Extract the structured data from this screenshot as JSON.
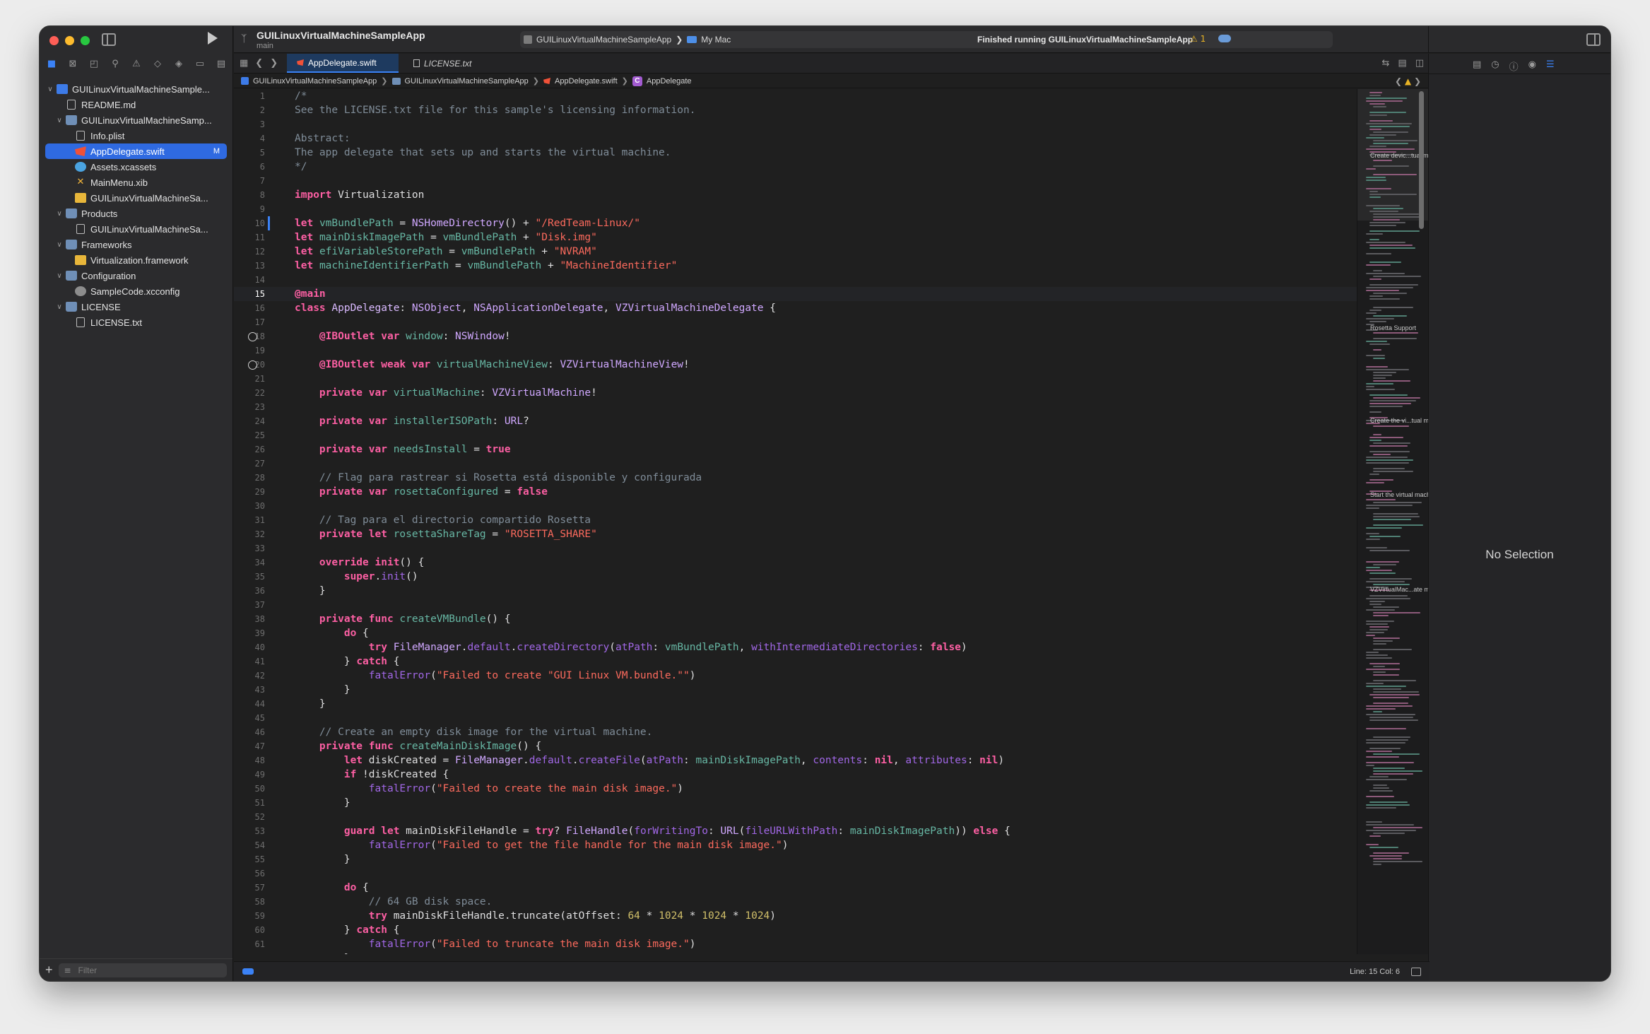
{
  "toolbar": {
    "project_title": "GUILinuxVirtualMachineSampleApp",
    "branch": "main",
    "scheme_target": "GUILinuxVirtualMachineSampleApp",
    "scheme_sep": "❯",
    "destination": "My Mac",
    "status": "Finished running GUILinuxVirtualMachineSampleApp",
    "warning_count": "⚠ 1",
    "add": "+"
  },
  "tabs": [
    {
      "label": "AppDelegate.swift"
    },
    {
      "label": "LICENSE.txt"
    }
  ],
  "jumpbar": [
    "GUILinuxVirtualMachineSampleApp",
    "GUILinuxVirtualMachineSampleApp",
    "AppDelegate.swift",
    "AppDelegate"
  ],
  "jumpbar_class_letter": "C",
  "navigator": {
    "items": [
      {
        "label": "GUILinuxVirtualMachineSample...",
        "icon": "project-icon",
        "indent": 0,
        "chev": "∨"
      },
      {
        "label": "README.md",
        "icon": "document-icon",
        "indent": 1,
        "chev": ""
      },
      {
        "label": "GUILinuxVirtualMachineSamp...",
        "icon": "folder-icon",
        "indent": 1,
        "chev": "∨"
      },
      {
        "label": "Info.plist",
        "icon": "plist-icon",
        "indent": 2,
        "chev": ""
      },
      {
        "label": "AppDelegate.swift",
        "icon": "swift-file-icon",
        "indent": 2,
        "chev": "",
        "selected": true,
        "badge": "M"
      },
      {
        "label": "Assets.xcassets",
        "icon": "assets-icon",
        "indent": 2,
        "chev": ""
      },
      {
        "label": "MainMenu.xib",
        "icon": "xib-icon",
        "indent": 2,
        "chev": ""
      },
      {
        "label": "GUILinuxVirtualMachineSa...",
        "icon": "entitlements-icon",
        "indent": 2,
        "chev": ""
      },
      {
        "label": "Products",
        "icon": "folder-icon",
        "indent": 1,
        "chev": "∨"
      },
      {
        "label": "GUILinuxVirtualMachineSa...",
        "icon": "app-product-icon",
        "indent": 2,
        "chev": ""
      },
      {
        "label": "Frameworks",
        "icon": "folder-icon",
        "indent": 1,
        "chev": "∨"
      },
      {
        "label": "Virtualization.framework",
        "icon": "framework-icon",
        "indent": 2,
        "chev": ""
      },
      {
        "label": "Configuration",
        "icon": "folder-icon",
        "indent": 1,
        "chev": "∨"
      },
      {
        "label": "SampleCode.xcconfig",
        "icon": "config-icon",
        "indent": 2,
        "chev": ""
      },
      {
        "label": "LICENSE",
        "icon": "folder-icon",
        "indent": 1,
        "chev": "∨"
      },
      {
        "label": "LICENSE.txt",
        "icon": "document-icon",
        "indent": 2,
        "chev": ""
      }
    ],
    "filter_placeholder": "Filter",
    "add": "+"
  },
  "editor": {
    "current_line": 15,
    "outlet_lines": [
      18,
      20
    ],
    "changed_lines": [
      10
    ],
    "lines": [
      [
        [
          "c",
          "/*"
        ]
      ],
      [
        [
          "c",
          "See the LICENSE.txt file for this sample's licensing information."
        ]
      ],
      [
        [
          "c",
          ""
        ]
      ],
      [
        [
          "c",
          "Abstract:"
        ]
      ],
      [
        [
          "c",
          "The app delegate that sets up and starts the virtual machine."
        ]
      ],
      [
        [
          "c",
          "*/"
        ]
      ],
      [],
      [
        [
          "k",
          "import"
        ],
        [
          "code",
          " Virtualization"
        ]
      ],
      [],
      [
        [
          "k",
          "let"
        ],
        [
          "code",
          " "
        ],
        [
          "v",
          "vmBundlePath"
        ],
        [
          "code",
          " = "
        ],
        [
          "t",
          "NSHomeDirectory"
        ],
        [
          "code",
          "() + "
        ],
        [
          "s",
          "\"/RedTeam-Linux/\""
        ]
      ],
      [
        [
          "k",
          "let"
        ],
        [
          "code",
          " "
        ],
        [
          "v",
          "mainDiskImagePath"
        ],
        [
          "code",
          " = "
        ],
        [
          "v",
          "vmBundlePath"
        ],
        [
          "code",
          " + "
        ],
        [
          "s",
          "\"Disk.img\""
        ]
      ],
      [
        [
          "k",
          "let"
        ],
        [
          "code",
          " "
        ],
        [
          "v",
          "efiVariableStorePath"
        ],
        [
          "code",
          " = "
        ],
        [
          "v",
          "vmBundlePath"
        ],
        [
          "code",
          " + "
        ],
        [
          "s",
          "\"NVRAM\""
        ]
      ],
      [
        [
          "k",
          "let"
        ],
        [
          "code",
          " "
        ],
        [
          "v",
          "machineIdentifierPath"
        ],
        [
          "code",
          " = "
        ],
        [
          "v",
          "vmBundlePath"
        ],
        [
          "code",
          " + "
        ],
        [
          "s",
          "\"MachineIdentifier\""
        ]
      ],
      [],
      [
        [
          "k",
          "@main"
        ]
      ],
      [
        [
          "k",
          "class"
        ],
        [
          "code",
          " "
        ],
        [
          "ty",
          "AppDelegate"
        ],
        [
          "code",
          ": "
        ],
        [
          "t",
          "NSObject"
        ],
        [
          "code",
          ", "
        ],
        [
          "t",
          "NSApplicationDelegate"
        ],
        [
          "code",
          ", "
        ],
        [
          "t",
          "VZVirtualMachineDelegate"
        ],
        [
          "code",
          " {"
        ]
      ],
      [],
      [
        [
          "code",
          "    "
        ],
        [
          "k",
          "@IBOutlet"
        ],
        [
          "code",
          " "
        ],
        [
          "k",
          "var"
        ],
        [
          "code",
          " "
        ],
        [
          "v",
          "window"
        ],
        [
          "code",
          ": "
        ],
        [
          "t",
          "NSWindow"
        ],
        [
          "code",
          "!"
        ]
      ],
      [],
      [
        [
          "code",
          "    "
        ],
        [
          "k",
          "@IBOutlet"
        ],
        [
          "code",
          " "
        ],
        [
          "k",
          "weak"
        ],
        [
          "code",
          " "
        ],
        [
          "k",
          "var"
        ],
        [
          "code",
          " "
        ],
        [
          "v",
          "virtualMachineView"
        ],
        [
          "code",
          ": "
        ],
        [
          "t",
          "VZVirtualMachineView"
        ],
        [
          "code",
          "!"
        ]
      ],
      [],
      [
        [
          "code",
          "    "
        ],
        [
          "k",
          "private"
        ],
        [
          "code",
          " "
        ],
        [
          "k",
          "var"
        ],
        [
          "code",
          " "
        ],
        [
          "v",
          "virtualMachine"
        ],
        [
          "code",
          ": "
        ],
        [
          "t",
          "VZVirtualMachine"
        ],
        [
          "code",
          "!"
        ]
      ],
      [],
      [
        [
          "code",
          "    "
        ],
        [
          "k",
          "private"
        ],
        [
          "code",
          " "
        ],
        [
          "k",
          "var"
        ],
        [
          "code",
          " "
        ],
        [
          "v",
          "installerISOPath"
        ],
        [
          "code",
          ": "
        ],
        [
          "t",
          "URL"
        ],
        [
          "code",
          "?"
        ]
      ],
      [],
      [
        [
          "code",
          "    "
        ],
        [
          "k",
          "private"
        ],
        [
          "code",
          " "
        ],
        [
          "k",
          "var"
        ],
        [
          "code",
          " "
        ],
        [
          "v",
          "needsInstall"
        ],
        [
          "code",
          " = "
        ],
        [
          "k",
          "true"
        ]
      ],
      [],
      [
        [
          "code",
          "    "
        ],
        [
          "c",
          "// Flag para rastrear si Rosetta está disponible y configurada"
        ]
      ],
      [
        [
          "code",
          "    "
        ],
        [
          "k",
          "private"
        ],
        [
          "code",
          " "
        ],
        [
          "k",
          "var"
        ],
        [
          "code",
          " "
        ],
        [
          "v",
          "rosettaConfigured"
        ],
        [
          "code",
          " = "
        ],
        [
          "k",
          "false"
        ]
      ],
      [],
      [
        [
          "code",
          "    "
        ],
        [
          "c",
          "// Tag para el directorio compartido Rosetta"
        ]
      ],
      [
        [
          "code",
          "    "
        ],
        [
          "k",
          "private"
        ],
        [
          "code",
          " "
        ],
        [
          "k",
          "let"
        ],
        [
          "code",
          " "
        ],
        [
          "v",
          "rosettaShareTag"
        ],
        [
          "code",
          " = "
        ],
        [
          "s",
          "\"ROSETTA_SHARE\""
        ]
      ],
      [],
      [
        [
          "code",
          "    "
        ],
        [
          "k",
          "override"
        ],
        [
          "code",
          " "
        ],
        [
          "k",
          "init"
        ],
        [
          "code",
          "() {"
        ]
      ],
      [
        [
          "code",
          "        "
        ],
        [
          "k",
          "super"
        ],
        [
          "code",
          "."
        ],
        [
          "p",
          "init"
        ],
        [
          "code",
          "()"
        ]
      ],
      [
        [
          "code",
          "    }"
        ]
      ],
      [],
      [
        [
          "code",
          "    "
        ],
        [
          "k",
          "private"
        ],
        [
          "code",
          " "
        ],
        [
          "k",
          "func"
        ],
        [
          "code",
          " "
        ],
        [
          "f",
          "createVMBundle"
        ],
        [
          "code",
          "() {"
        ]
      ],
      [
        [
          "code",
          "        "
        ],
        [
          "k",
          "do"
        ],
        [
          "code",
          " {"
        ]
      ],
      [
        [
          "code",
          "            "
        ],
        [
          "k",
          "try"
        ],
        [
          "code",
          " "
        ],
        [
          "t",
          "FileManager"
        ],
        [
          "code",
          "."
        ],
        [
          "p",
          "default"
        ],
        [
          "code",
          "."
        ],
        [
          "p",
          "createDirectory"
        ],
        [
          "code",
          "("
        ],
        [
          "p",
          "atPath"
        ],
        [
          "code",
          ": "
        ],
        [
          "v",
          "vmBundlePath"
        ],
        [
          "code",
          ", "
        ],
        [
          "p",
          "withIntermediateDirectories"
        ],
        [
          "code",
          ": "
        ],
        [
          "k",
          "false"
        ],
        [
          "code",
          ")"
        ]
      ],
      [
        [
          "code",
          "        } "
        ],
        [
          "k",
          "catch"
        ],
        [
          "code",
          " {"
        ]
      ],
      [
        [
          "code",
          "            "
        ],
        [
          "p",
          "fatalError"
        ],
        [
          "code",
          "("
        ],
        [
          "s",
          "\"Failed to create \"GUI Linux VM.bundle.\"\""
        ],
        [
          "code",
          ")"
        ]
      ],
      [
        [
          "code",
          "        }"
        ]
      ],
      [
        [
          "code",
          "    }"
        ]
      ],
      [],
      [
        [
          "code",
          "    "
        ],
        [
          "c",
          "// Create an empty disk image for the virtual machine."
        ]
      ],
      [
        [
          "code",
          "    "
        ],
        [
          "k",
          "private"
        ],
        [
          "code",
          " "
        ],
        [
          "k",
          "func"
        ],
        [
          "code",
          " "
        ],
        [
          "f",
          "createMainDiskImage"
        ],
        [
          "code",
          "() {"
        ]
      ],
      [
        [
          "code",
          "        "
        ],
        [
          "k",
          "let"
        ],
        [
          "code",
          " diskCreated = "
        ],
        [
          "t",
          "FileManager"
        ],
        [
          "code",
          "."
        ],
        [
          "p",
          "default"
        ],
        [
          "code",
          "."
        ],
        [
          "p",
          "createFile"
        ],
        [
          "code",
          "("
        ],
        [
          "p",
          "atPath"
        ],
        [
          "code",
          ": "
        ],
        [
          "v",
          "mainDiskImagePath"
        ],
        [
          "code",
          ", "
        ],
        [
          "p",
          "contents"
        ],
        [
          "code",
          ": "
        ],
        [
          "k",
          "nil"
        ],
        [
          "code",
          ", "
        ],
        [
          "p",
          "attributes"
        ],
        [
          "code",
          ": "
        ],
        [
          "k",
          "nil"
        ],
        [
          "code",
          ")"
        ]
      ],
      [
        [
          "code",
          "        "
        ],
        [
          "k",
          "if"
        ],
        [
          "code",
          " !diskCreated {"
        ]
      ],
      [
        [
          "code",
          "            "
        ],
        [
          "p",
          "fatalError"
        ],
        [
          "code",
          "("
        ],
        [
          "s",
          "\"Failed to create the main disk image.\""
        ],
        [
          "code",
          ")"
        ]
      ],
      [
        [
          "code",
          "        }"
        ]
      ],
      [],
      [
        [
          "code",
          "        "
        ],
        [
          "k",
          "guard"
        ],
        [
          "code",
          " "
        ],
        [
          "k",
          "let"
        ],
        [
          "code",
          " mainDiskFileHandle = "
        ],
        [
          "k",
          "try"
        ],
        [
          "code",
          "? "
        ],
        [
          "t",
          "FileHandle"
        ],
        [
          "code",
          "("
        ],
        [
          "p",
          "forWritingTo"
        ],
        [
          "code",
          ": "
        ],
        [
          "t",
          "URL"
        ],
        [
          "code",
          "("
        ],
        [
          "p",
          "fileURLWithPath"
        ],
        [
          "code",
          ": "
        ],
        [
          "v",
          "mainDiskImagePath"
        ],
        [
          "code",
          ")) "
        ],
        [
          "k",
          "else"
        ],
        [
          "code",
          " {"
        ]
      ],
      [
        [
          "code",
          "            "
        ],
        [
          "p",
          "fatalError"
        ],
        [
          "code",
          "("
        ],
        [
          "s",
          "\"Failed to get the file handle for the main disk image.\""
        ],
        [
          "code",
          ")"
        ]
      ],
      [
        [
          "code",
          "        }"
        ]
      ],
      [],
      [
        [
          "code",
          "        "
        ],
        [
          "k",
          "do"
        ],
        [
          "code",
          " {"
        ]
      ],
      [
        [
          "code",
          "            "
        ],
        [
          "c",
          "// 64 GB disk space."
        ]
      ],
      [
        [
          "code",
          "            "
        ],
        [
          "k",
          "try"
        ],
        [
          "code",
          " mainDiskFileHandle.truncate(atOffset: "
        ],
        [
          "n",
          "64"
        ],
        [
          "code",
          " * "
        ],
        [
          "n",
          "1024"
        ],
        [
          "code",
          " * "
        ],
        [
          "n",
          "1024"
        ],
        [
          "code",
          " * "
        ],
        [
          "n",
          "1024"
        ],
        [
          "code",
          ")"
        ]
      ],
      [
        [
          "code",
          "        } "
        ],
        [
          "k",
          "catch"
        ],
        [
          "code",
          " {"
        ]
      ],
      [
        [
          "code",
          "            "
        ],
        [
          "p",
          "fatalError"
        ],
        [
          "code",
          "("
        ],
        [
          "s",
          "\"Failed to truncate the main disk image.\""
        ],
        [
          "code",
          ")"
        ]
      ],
      [
        [
          "code",
          "        }"
        ]
      ]
    ]
  },
  "minimap": {
    "labels": [
      {
        "text": "Create devic...tual machine.",
        "line": 220
      },
      {
        "text": "Rosetta Support",
        "line": 464
      },
      {
        "text": "Create the vi...tual machine.",
        "line": 595
      },
      {
        "text": "Start the virtual machine.",
        "line": 700
      },
      {
        "text": "VZVirtualMac...ate methods.",
        "line": 834
      }
    ]
  },
  "inspector": {
    "empty_text": "No Selection"
  },
  "statusbar": {
    "position": "Line: 15  Col: 6"
  }
}
